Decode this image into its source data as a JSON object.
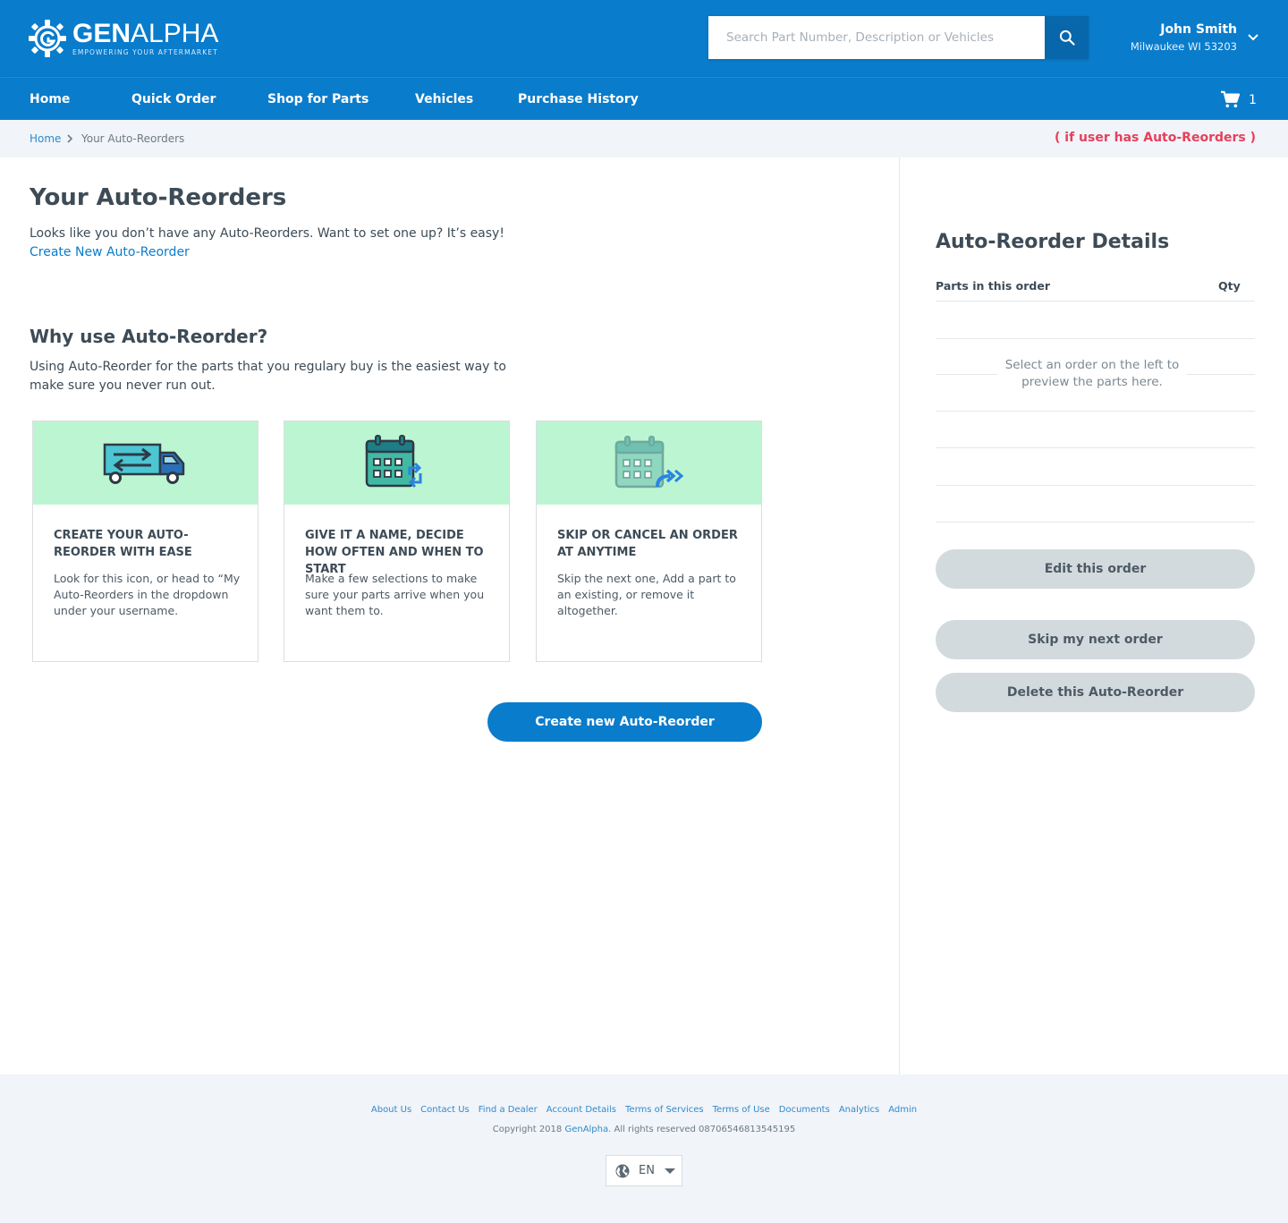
{
  "brand": {
    "name_bold": "GEN",
    "name_rest": "ALPHA",
    "tagline": "EMPOWERING YOUR AFTERMARKET",
    "primary_color": "#0a7ccc",
    "accent_color": "#bcf5d1",
    "alert_color": "#e5405e"
  },
  "search": {
    "placeholder": "Search Part Number, Description or Vehicles",
    "value": "",
    "icon": "search-icon"
  },
  "user": {
    "name": "John Smith",
    "location": "Milwaukee WI 53203",
    "icon": "chevron-down-icon"
  },
  "nav": {
    "items": [
      "Home",
      "Quick Order",
      "Shop for Parts",
      "Vehicles",
      "Purchase History"
    ],
    "cart_count": "1",
    "cart_icon": "shopping-cart-icon"
  },
  "breadcrumb": {
    "home": "Home",
    "current": "Your Auto-Reorders",
    "note": "( if user has Auto-Reorders )"
  },
  "main": {
    "title": "Your Auto-Reorders",
    "empty_message": "Looks like you don’t have any Auto-Reorders. Want to set one up? It’s easy!",
    "create_link": "Create New Auto-Reorder",
    "why_title": "Why use Auto-Reorder?",
    "why_text": "Using Auto-Reorder for the parts that you regulary buy is the easiest way to make sure you never run out.",
    "cards": [
      {
        "icon": "truck-icon",
        "title": "Create your Auto-Reorder with ease",
        "description": "Look for this icon, or head to “My Auto-Reorders in the dropdown under your username."
      },
      {
        "icon": "recurring-calendar-icon",
        "title": "Give it a name, decide how often and when to start",
        "description": "Make a few selections to make sure your parts arrive when you want them to."
      },
      {
        "icon": "skip-calendar-icon",
        "title": "Skip or cancel an order at anytime",
        "description": "Skip the next one, Add a part to an existing, or remove it altogether."
      }
    ],
    "cta": "Create new Auto-Reorder"
  },
  "details": {
    "title": "Auto-Reorder Details",
    "col_parts": "Parts in this order",
    "col_qty": "Qty",
    "empty_note": "Select an order on the left to preview the parts here.",
    "buttons": {
      "edit": "Edit this order",
      "skip": "Skip my next order",
      "delete": "Delete this Auto-Reorder"
    }
  },
  "footer": {
    "links": [
      "About Us",
      "Contact Us",
      "Find a Dealer",
      "Account Details",
      "Terms of Services",
      "Terms of Use",
      "Documents",
      "Analytics",
      "Admin"
    ],
    "copyright_prefix": "Copyright 2018 ",
    "copyright_brand": "GenAlpha",
    "copyright_suffix": ". All rights reserved 08706546813545195",
    "language": "EN",
    "language_icon": "globe-icon"
  }
}
